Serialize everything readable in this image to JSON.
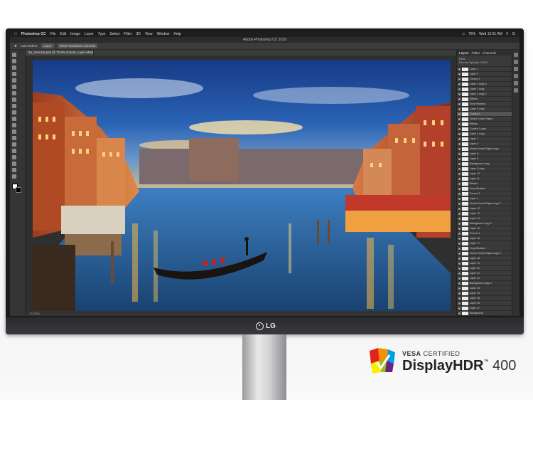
{
  "mac_menubar": {
    "app_name": "Photoshop CC",
    "menus": [
      "File",
      "Edit",
      "Image",
      "Layer",
      "Type",
      "Select",
      "Filter",
      "3D",
      "View",
      "Window",
      "Help"
    ],
    "battery": "76%",
    "clock": "Wed 12:01 AM"
  },
  "app_window_title": "Adobe Photoshop CC 2018",
  "options_bar": {
    "auto_select_label": "Auto-Select:",
    "auto_select_value": "Layer",
    "transform_label": "Show Transform Controls"
  },
  "document_tab": "3a_Venezia.psd @ 70.8% (Canal, Layer Mask/8)",
  "status_bar": "70.78%",
  "panels": {
    "tabs": [
      "Layers",
      "Paths",
      "Channels"
    ],
    "filter_label": "Kind",
    "blend_mode": "Normal",
    "opacity_label": "Opacity: 100%",
    "fill_label": "Fill: 100%",
    "layers": [
      "Layer 1",
      "Layer 2",
      "Curves 1",
      "Layer 3 copy 4",
      "Layer 2 copy",
      "Layer 4 copy 2",
      "Effects",
      "Drop Shadow",
      "Layer 4 copy",
      "Curves 2",
      "Vector Smart Object",
      "Effects",
      "Curves 1 copy",
      "Layer 3 copy",
      "Layer 7",
      "Layer 8",
      "Vector Smart Object copy",
      "Layer 6",
      "Layer 5",
      "Background copy",
      "Layer 8 copy",
      "Layer 10",
      "Layer 11",
      "Effects",
      "Drop Shadow",
      "Curves 3",
      "Layer 3",
      "Vector Smart Object copy 2",
      "Layer 12",
      "Layer 13",
      "Layer 14",
      "Background copy 2",
      "Layer 15",
      "Curves 4",
      "Layer 16",
      "Layer 17",
      "Drop Shadow",
      "Vector Smart Object copy 3",
      "Layer 18",
      "Layer 19",
      "Layer 20",
      "Layer 21",
      "Layer 22",
      "Background copy 3",
      "Layer 23",
      "Layer 24",
      "Layer 25",
      "Layer 26",
      "Layer 27",
      "Background"
    ]
  },
  "brand": "LG",
  "badge": {
    "line1_bold": "VESA",
    "line1_rest": " CERTIFIED",
    "product": "DisplayHDR",
    "tm": "™",
    "number": " 400"
  },
  "colors": {
    "sky_top": "#1d3f8a",
    "sunset": "#f0b060",
    "water": "#2f6fb0",
    "buildings_warm": "#c8643a"
  }
}
